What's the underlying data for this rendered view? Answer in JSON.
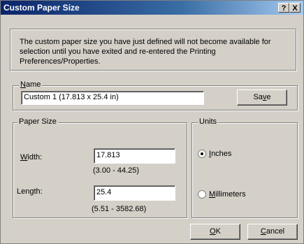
{
  "window": {
    "title": "Custom Paper Size",
    "help_button": "?",
    "close_button": "X"
  },
  "info": {
    "text": "The custom paper size you have just defined will not become available for selection until you have exited and re-entered the Printing Preferences/Properties."
  },
  "name_group": {
    "label_first": "N",
    "label_rest": "ame",
    "value": "Custom 1 (17.813 x 25.4 in)",
    "save_pre": "Sa",
    "save_u": "v",
    "save_post": "e"
  },
  "paper_size": {
    "label": "Paper Size",
    "width_label_first": "W",
    "width_label_rest": "idth:",
    "width_value": "17.813",
    "width_range": "(3.00 - 44.25)",
    "length_label_pre": "Len",
    "length_label_u": "g",
    "length_label_post": "th:",
    "length_value": "25.4",
    "length_range": "(5.51 - 3582.68)"
  },
  "units": {
    "label": "Units",
    "inches_first": "I",
    "inches_rest": "nches",
    "inches_selected": true,
    "mm_first": "M",
    "mm_rest": "illimeters",
    "mm_selected": false
  },
  "buttons": {
    "ok_first": "O",
    "ok_rest": "K",
    "cancel_first": "C",
    "cancel_rest": "ancel"
  }
}
